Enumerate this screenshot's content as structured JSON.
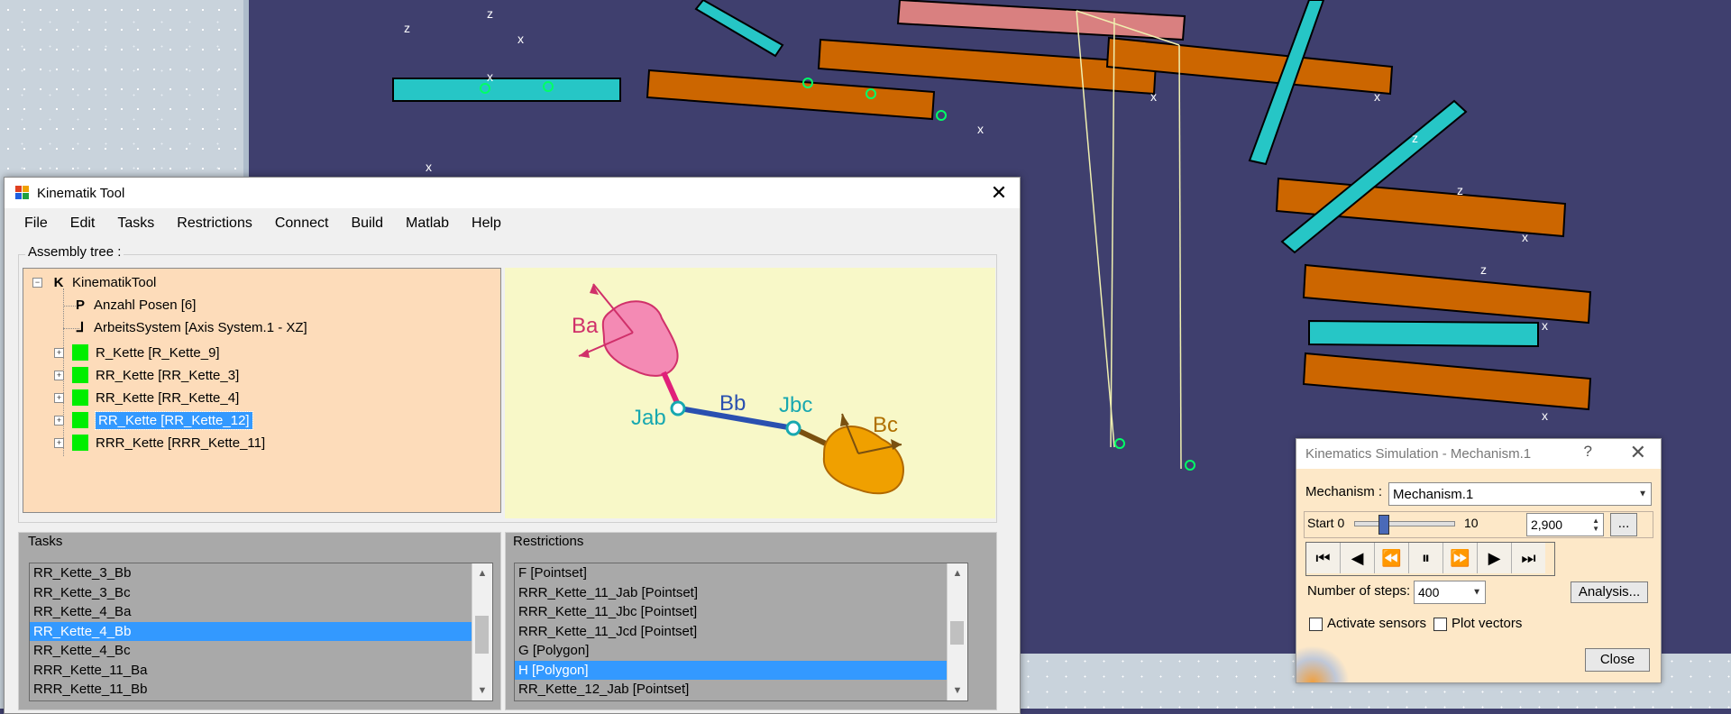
{
  "main_window": {
    "title": "Kinematik Tool",
    "menu": [
      "File",
      "Edit",
      "Tasks",
      "Restrictions",
      "Connect",
      "Build",
      "Matlab",
      "Help"
    ],
    "assembly_tree_label": "Assembly tree :",
    "tree": [
      {
        "glyph": "K",
        "label": "KinematikTool"
      },
      {
        "glyph": "P",
        "label": "Anzahl Posen [6]"
      },
      {
        "glyph": "axis-icon",
        "label": "ArbeitsSystem [Axis System.1 - XZ]"
      },
      {
        "glyph": "green-box",
        "label": "R_Kette [R_Kette_9]"
      },
      {
        "glyph": "green-box",
        "label": "RR_Kette [RR_Kette_3]"
      },
      {
        "glyph": "green-box",
        "label": "RR_Kette [RR_Kette_4]"
      },
      {
        "glyph": "green-box",
        "label": "RR_Kette [RR_Kette_12]",
        "selected": true
      },
      {
        "glyph": "green-box",
        "label": "RRR_Kette [RRR_Kette_11]"
      }
    ],
    "diagram_labels": {
      "ba": "Ba",
      "jab": "Jab",
      "bb": "Bb",
      "jbc": "Jbc",
      "bc": "Bc"
    },
    "tasks_label": "Tasks",
    "tasks": [
      "RR_Kette_3_Bb",
      "RR_Kette_3_Bc",
      "RR_Kette_4_Ba",
      "RR_Kette_4_Bb",
      "RR_Kette_4_Bc",
      "RRR_Kette_11_Ba",
      "RRR_Kette_11_Bb"
    ],
    "tasks_selected": "RR_Kette_4_Bb",
    "restrictions_label": "Restrictions",
    "restrictions": [
      "F [Pointset]",
      "RRR_Kette_11_Jab [Pointset]",
      "RRR_Kette_11_Jbc [Pointset]",
      "RRR_Kette_11_Jcd [Pointset]",
      "G [Polygon]",
      "H [Polygon]",
      "RR_Kette_12_Jab [Pointset]"
    ],
    "restrictions_selected": "H [Polygon]"
  },
  "simulation": {
    "title": "Kinematics Simulation - Mechanism.1",
    "help": "?",
    "mechanism_label": "Mechanism :",
    "mechanism_value": "Mechanism.1",
    "start_label": "Start 0",
    "end_label": "10",
    "time_value": "2,900",
    "more_button": "...",
    "slider_fraction": 0.29,
    "steps_label": "Number of steps:",
    "steps_value": "400",
    "analysis_button": "Analysis...",
    "activate_sensors": "Activate sensors",
    "plot_vectors": "Plot vectors",
    "close_button": "Close"
  },
  "colors": {
    "teal": "#1fbfbf",
    "orange": "#cc6600",
    "pink": "#d98080",
    "viewport": "#3f3f6e",
    "selection": "#3399ff"
  }
}
